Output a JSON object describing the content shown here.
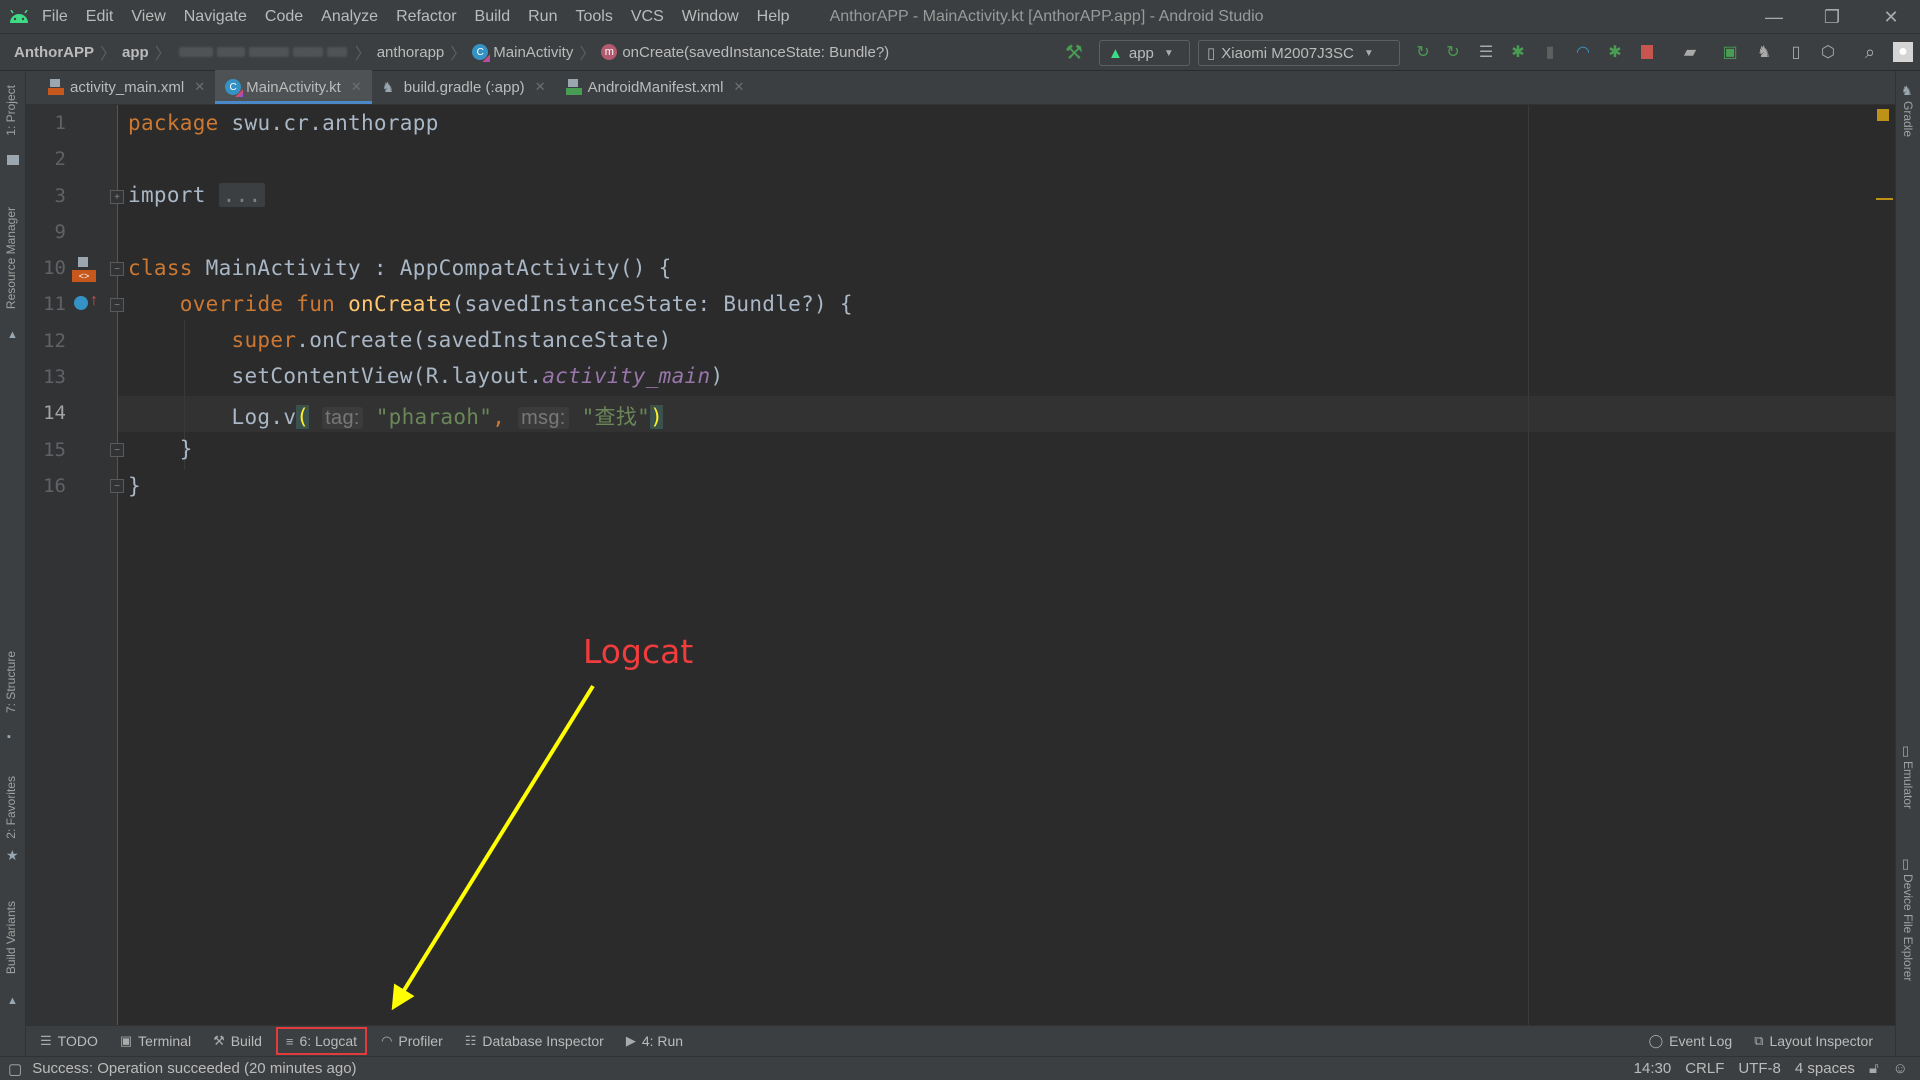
{
  "window": {
    "title": "AnthorAPP - MainActivity.kt [AnthorAPP.app] - Android Studio",
    "controls": {
      "minimize": "—",
      "restore": "❐",
      "close": "✕"
    }
  },
  "menu": [
    "File",
    "Edit",
    "View",
    "Navigate",
    "Code",
    "Analyze",
    "Refactor",
    "Build",
    "Run",
    "Tools",
    "VCS",
    "Window",
    "Help"
  ],
  "breadcrumb": {
    "project": "AnthorAPP",
    "module": "app",
    "package": "anthorapp",
    "class": "MainActivity",
    "method": "onCreate(savedInstanceState: Bundle?)"
  },
  "toolbar": {
    "run_config": "app",
    "device": "Xiaomi M2007J3SC",
    "icons": [
      "hammer-icon",
      "apply-changes-restart-icon",
      "apply-code-changes-icon",
      "sync-icon",
      "debug-icon",
      "attach-debugger-icon",
      "profile-icon",
      "debug-attach-icon",
      "stop-icon",
      "sdk-manager-icon",
      "avd-manager-icon",
      "gradle-sync-icon",
      "device-manager-icon",
      "sdk-download-icon",
      "search-icon",
      "account-icon"
    ]
  },
  "tabs": [
    {
      "label": "activity_main.xml",
      "icon": "xml-layout-icon",
      "active": false
    },
    {
      "label": "MainActivity.kt",
      "icon": "kotlin-class-icon",
      "active": true
    },
    {
      "label": "build.gradle (:app)",
      "icon": "gradle-icon",
      "active": false
    },
    {
      "label": "AndroidManifest.xml",
      "icon": "manifest-icon",
      "active": false
    }
  ],
  "left_tools": [
    "1: Project",
    "Resource Manager",
    "7: Structure",
    "2: Favorites",
    "Build Variants"
  ],
  "right_tools": [
    "Gradle",
    "Emulator",
    "Device File Explorer"
  ],
  "editor": {
    "current_line": "14",
    "lines": [
      {
        "num": "1"
      },
      {
        "num": "2"
      },
      {
        "num": "3"
      },
      {
        "num": "9"
      },
      {
        "num": "10"
      },
      {
        "num": "11"
      },
      {
        "num": "12"
      },
      {
        "num": "13"
      },
      {
        "num": "14"
      },
      {
        "num": "15"
      },
      {
        "num": "16"
      }
    ],
    "code": {
      "l1_kw": "package",
      "l1_rest": " swu.cr.anthorapp",
      "l3_kw": "import",
      "l3_fold": "...",
      "l10_kw": "class",
      "l10_rest": " MainActivity : AppCompatActivity() {",
      "l11_kw1": "override",
      "l11_kw2": "fun",
      "l11_fn": "onCreate",
      "l11_rest": "(savedInstanceState: Bundle?) {",
      "l12_kw": "super",
      "l12_rest": ".onCreate(savedInstanceState)",
      "l13_pre": "setContentView(R.layout.",
      "l13_it": "activity_main",
      "l13_post": ")",
      "l14_pre": "Log.v",
      "l14_open": "(",
      "l14_hint1": "tag:",
      "l14_str1": "\"pharaoh\"",
      "l14_comma": ",",
      "l14_hint2": "msg:",
      "l14_str2": "\"查找\"",
      "l14_close": ")",
      "l15": "}",
      "l16": "}"
    }
  },
  "annotation": {
    "label": "Logcat",
    "color": "#f03c3c",
    "arrow_color": "#ffff00"
  },
  "bottom_tools": [
    {
      "label": "TODO",
      "icon": "todo-icon"
    },
    {
      "label": "Terminal",
      "icon": "terminal-icon"
    },
    {
      "label": "Build",
      "icon": "hammer-icon"
    },
    {
      "label": "6: Logcat",
      "icon": "logcat-icon",
      "highlighted": true
    },
    {
      "label": "Profiler",
      "icon": "profiler-icon"
    },
    {
      "label": "Database Inspector",
      "icon": "database-icon"
    },
    {
      "label": "4: Run",
      "icon": "run-icon"
    }
  ],
  "bottom_tools_right": [
    {
      "label": "Event Log",
      "icon": "event-log-icon"
    },
    {
      "label": "Layout Inspector",
      "icon": "layout-inspector-icon"
    }
  ],
  "status": {
    "message": "Success: Operation succeeded (20 minutes ago)",
    "position": "14:30",
    "line_separator": "CRLF",
    "encoding": "UTF-8",
    "indent": "4 spaces"
  },
  "colors": {
    "accent_tab": "#4a88c7",
    "keyword": "#cc7832",
    "function": "#ffc66d",
    "string": "#6a8759",
    "highlight_box": "#e23b3b"
  }
}
